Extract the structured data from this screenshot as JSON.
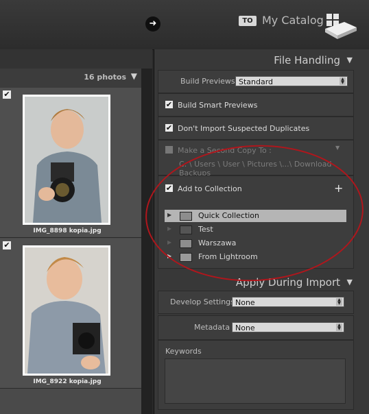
{
  "header": {
    "to_label": "TO",
    "catalog_name": "My Catalog",
    "icons": [
      "arrow-right-icon",
      "hard-drive-icon"
    ]
  },
  "grid": {
    "photo_count": "16 photos",
    "photos": [
      {
        "filename": "IMG_8898 kopia.jpg",
        "checked": true
      },
      {
        "filename": "IMG_8922 kopia.jpg",
        "checked": true
      }
    ]
  },
  "file_handling": {
    "title": "File Handling",
    "build_previews_label": "Build Previews",
    "build_previews_value": "Standard",
    "smart_previews_label": "Build Smart Previews",
    "duplicates_label": "Don't Import Suspected Duplicates",
    "second_copy_label": "Make a Second Copy To :",
    "second_copy_path": "C: \\ Users \\ User \\ Pictures \\...\\ Download Backups",
    "add_to_collection_label": "Add to Collection",
    "collections": [
      "Quick Collection",
      "Test",
      "Warszawa",
      "From Lightroom"
    ]
  },
  "apply_during_import": {
    "title": "Apply During Import",
    "develop_settings_label": "Develop Settings",
    "develop_settings_value": "None",
    "metadata_label": "Metadata",
    "metadata_value": "None",
    "keywords_label": "Keywords"
  }
}
